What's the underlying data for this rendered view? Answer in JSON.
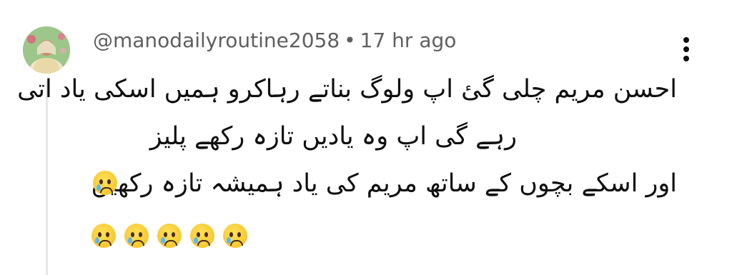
{
  "comment": {
    "author": "@manodailyroutine2058",
    "separator": "•",
    "time": "17 hr ago",
    "lines": [
      "احسن مریم چلی گئ اپ ولوگ بناتے رہاکرو ہمیں اسکی یاد اتی",
      "رہے گی اپ وہ یادیں تازہ رکھے پلیز",
      "اور اسکے بچوں کے ساتھ مریم کی یاد ہمیشہ تازہ رکھیں"
    ],
    "emoji_inline": "crying-face",
    "emoji_row": [
      "crying-face",
      "crying-face",
      "crying-face",
      "crying-face",
      "crying-face"
    ]
  },
  "icons": {
    "more": "more-vertical-icon",
    "avatar": "user-avatar"
  },
  "colors": {
    "text": "#0f0f0f",
    "meta": "#606060",
    "thread": "#e6e6e6",
    "emoji": "#f6c832"
  }
}
